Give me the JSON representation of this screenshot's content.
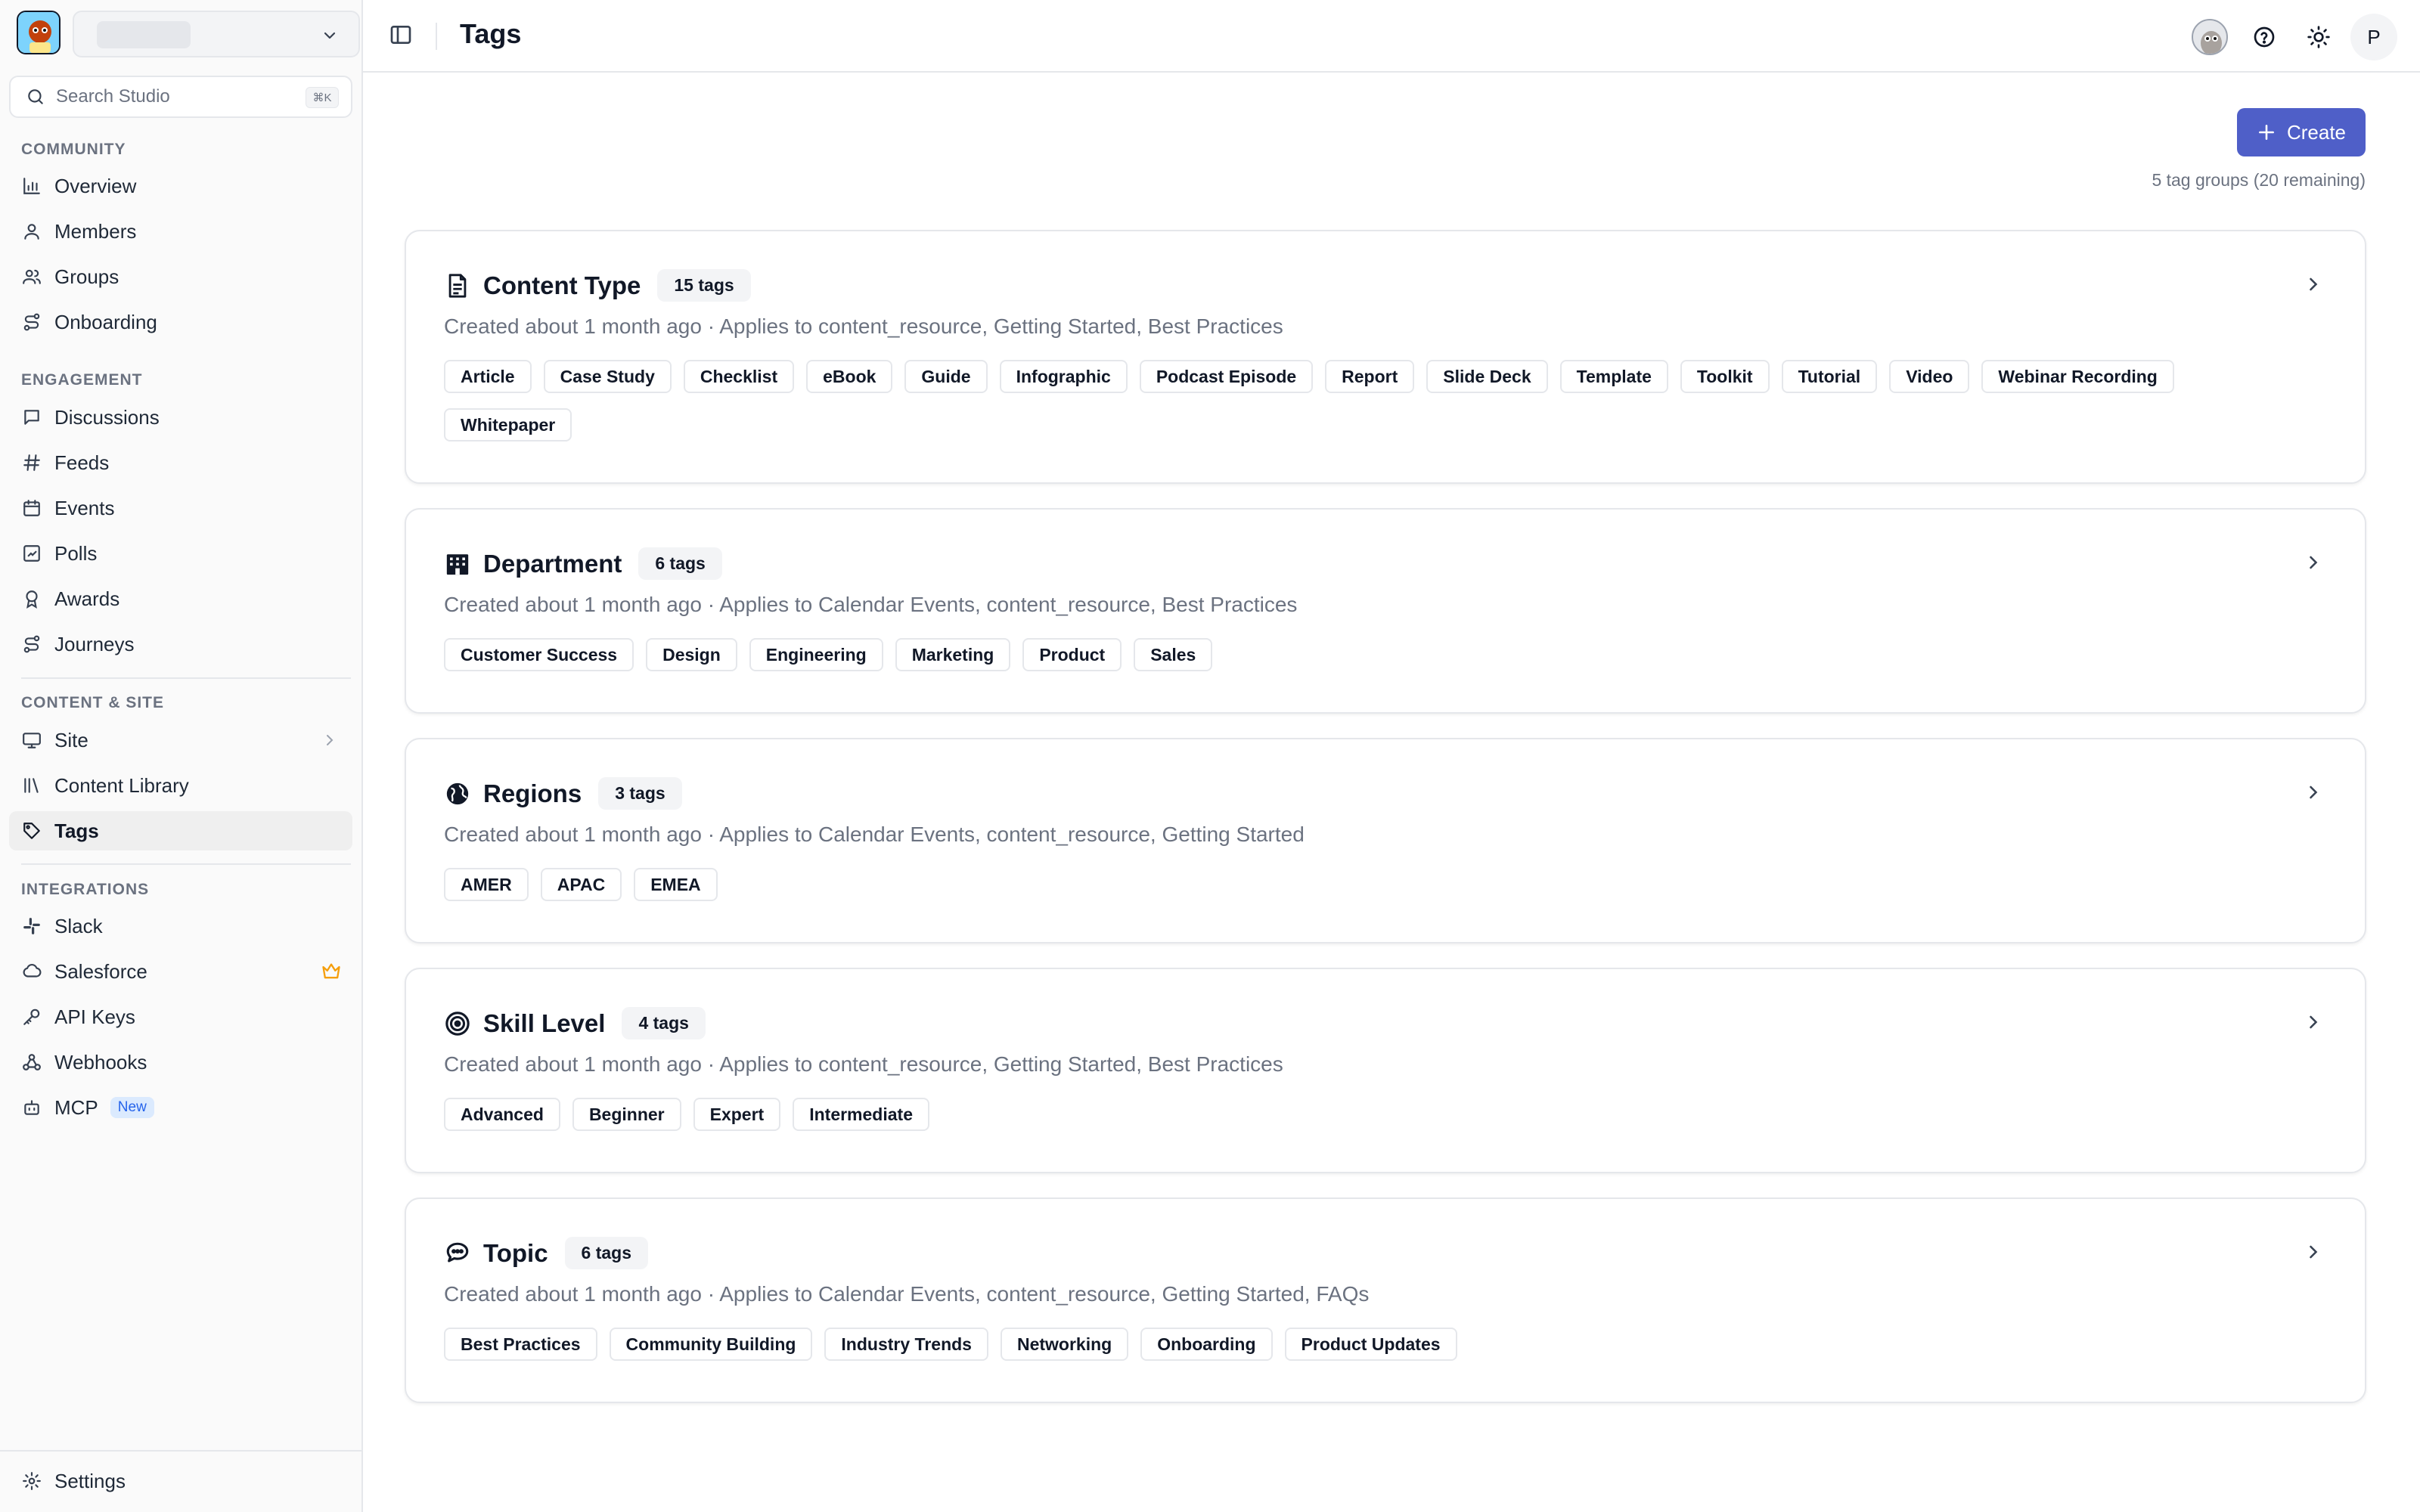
{
  "app": {
    "page_title": "Tags",
    "search_placeholder": "Search Studio",
    "search_shortcut": "⌘K"
  },
  "sidebar": {
    "sections": [
      {
        "title": "Community",
        "items": [
          {
            "label": "Overview",
            "icon": "chart-icon"
          },
          {
            "label": "Members",
            "icon": "user-icon"
          },
          {
            "label": "Groups",
            "icon": "users-icon"
          },
          {
            "label": "Onboarding",
            "icon": "route-icon"
          }
        ]
      },
      {
        "title": "Engagement",
        "items": [
          {
            "label": "Discussions",
            "icon": "message-icon"
          },
          {
            "label": "Feeds",
            "icon": "hash-icon"
          },
          {
            "label": "Events",
            "icon": "calendar-icon"
          },
          {
            "label": "Polls",
            "icon": "poll-icon"
          },
          {
            "label": "Awards",
            "icon": "award-icon"
          },
          {
            "label": "Journeys",
            "icon": "route-icon"
          }
        ]
      },
      {
        "title": "Content & Site",
        "items": [
          {
            "label": "Site",
            "icon": "monitor-icon"
          },
          {
            "label": "Content Library",
            "icon": "library-icon"
          },
          {
            "label": "Tags",
            "icon": "tag-icon",
            "active": true
          }
        ]
      },
      {
        "title": "Integrations",
        "items": [
          {
            "label": "Slack",
            "icon": "slack-icon"
          },
          {
            "label": "Salesforce",
            "icon": "cloud-icon"
          },
          {
            "label": "API Keys",
            "icon": "key-icon"
          },
          {
            "label": "Webhooks",
            "icon": "webhook-icon"
          },
          {
            "label": "MCP",
            "icon": "bot-icon",
            "badge": "New"
          }
        ]
      }
    ],
    "settings_label": "Settings"
  },
  "header": {
    "user_initial": "P"
  },
  "main": {
    "create_label": "Create",
    "summary": "5 tag groups (20 remaining)",
    "groups": [
      {
        "name": "Content Type",
        "icon": "document-icon",
        "count": "15 tags",
        "meta": "Created about 1 month ago · Applies to content_resource, Getting Started, Best Practices",
        "tags": [
          "Article",
          "Case Study",
          "Checklist",
          "eBook",
          "Guide",
          "Infographic",
          "Podcast Episode",
          "Report",
          "Slide Deck",
          "Template",
          "Toolkit",
          "Tutorial",
          "Video",
          "Webinar Recording",
          "Whitepaper"
        ]
      },
      {
        "name": "Department",
        "icon": "building-icon",
        "count": "6 tags",
        "meta": "Created about 1 month ago · Applies to Calendar Events, content_resource, Best Practices",
        "tags": [
          "Customer Success",
          "Design",
          "Engineering",
          "Marketing",
          "Product",
          "Sales"
        ]
      },
      {
        "name": "Regions",
        "icon": "globe-icon",
        "count": "3 tags",
        "meta": "Created about 1 month ago · Applies to Calendar Events, content_resource, Getting Started",
        "tags": [
          "AMER",
          "APAC",
          "EMEA"
        ]
      },
      {
        "name": "Skill Level",
        "icon": "target-icon",
        "count": "4 tags",
        "meta": "Created about 1 month ago · Applies to content_resource, Getting Started, Best Practices",
        "tags": [
          "Advanced",
          "Beginner",
          "Expert",
          "Intermediate"
        ]
      },
      {
        "name": "Topic",
        "icon": "speech-bubble-icon",
        "count": "6 tags",
        "meta": "Created about 1 month ago · Applies to Calendar Events, content_resource, Getting Started, FAQs",
        "tags": [
          "Best Practices",
          "Community Building",
          "Industry Trends",
          "Networking",
          "Onboarding",
          "Product Updates"
        ]
      }
    ]
  },
  "colors": {
    "accent": "#4f5fc8",
    "crown": "#f59e0b",
    "badge_new_bg": "#dbeafe",
    "badge_new_fg": "#2563eb"
  }
}
